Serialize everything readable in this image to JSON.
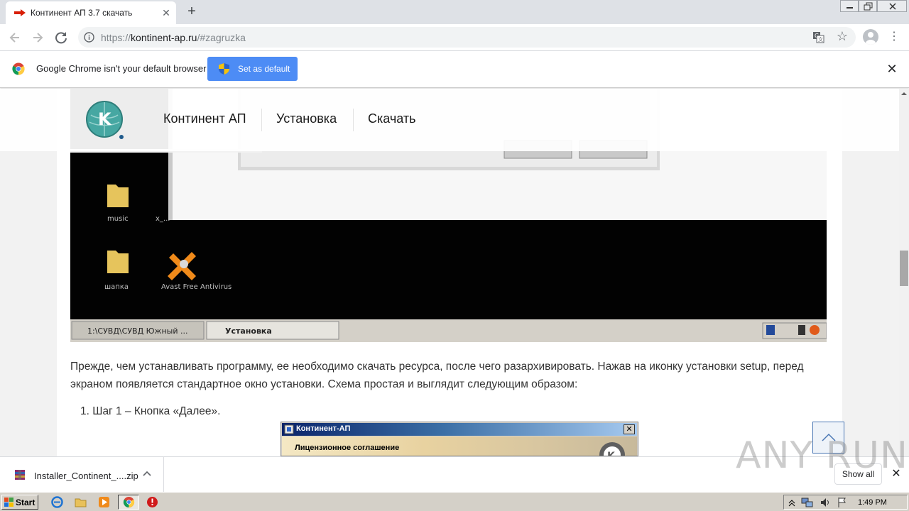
{
  "browser": {
    "tab_title": "Континент АП 3.7 скачать",
    "url_scheme": "https://",
    "url_host": "kontinent-ap.ru",
    "url_path": "/#zagruzka"
  },
  "infobar": {
    "message": "Google Chrome isn't your default browser",
    "button": "Set as default"
  },
  "site": {
    "nav": [
      "Континент АП",
      "Установка",
      "Скачать"
    ]
  },
  "embedded_screenshot": {
    "desktop_icons": [
      "music",
      "x_...",
      "шапка",
      "Avast Free Antivirus"
    ],
    "taskbar_items": [
      "1:\\СУВД\\СУВД Южный ...",
      "Установка"
    ]
  },
  "article": {
    "paragraph": "Прежде, чем устанавливать программу, ее необходимо скачать ресурса, после чего разархивировать. Нажав на иконку установки setup, перед экраном появляется стандартное окно установки. Схема простая и выглядит следующим образом:",
    "step1": "1.  Шаг 1 – Кнопка «Далее».",
    "installer_title": "Континент-АП",
    "installer_subtitle": "Лицензионное соглашение"
  },
  "downloads": {
    "filename": "Installer_Continent_....zip",
    "show_all": "Show all"
  },
  "watermark": "ANY RUN",
  "taskbar": {
    "start": "Start",
    "clock": "1:49 PM"
  }
}
